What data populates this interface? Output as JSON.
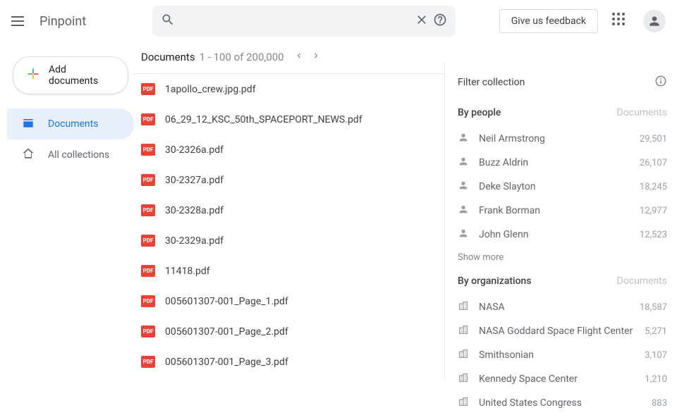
{
  "header": {
    "brand": "Pinpoint",
    "search_placeholder": "",
    "feedback_label": "Give us feedback"
  },
  "sidebar": {
    "add_label": "Add documents",
    "nav": [
      {
        "label": "Documents",
        "active": true
      },
      {
        "label": "All collections",
        "active": false
      }
    ]
  },
  "docs": {
    "title": "Documents",
    "range": "1 - 100 of 200,000",
    "items": [
      {
        "name": "1apollo_crew.jpg.pdf"
      },
      {
        "name": "06_29_12_KSC_50th_SPACEPORT_NEWS.pdf"
      },
      {
        "name": "30-2326a.pdf"
      },
      {
        "name": "30-2327a.pdf"
      },
      {
        "name": "30-2328a.pdf"
      },
      {
        "name": "30-2329a.pdf"
      },
      {
        "name": "11418.pdf"
      },
      {
        "name": "005601307-001_Page_1.pdf"
      },
      {
        "name": "005601307-001_Page_2.pdf"
      },
      {
        "name": "005601307-001_Page_3.pdf"
      }
    ]
  },
  "filter": {
    "title": "Filter collection",
    "people": {
      "label": "By people",
      "doclabel": "Documents",
      "items": [
        {
          "name": "Neil Armstrong",
          "count": "29,501"
        },
        {
          "name": "Buzz Aldrin",
          "count": "26,107"
        },
        {
          "name": "Deke Slayton",
          "count": "18,245"
        },
        {
          "name": "Frank Borman",
          "count": "12,977"
        },
        {
          "name": "John Glenn",
          "count": "12,523"
        }
      ],
      "show_more": "Show more"
    },
    "orgs": {
      "label": "By organizations",
      "doclabel": "Documents",
      "items": [
        {
          "name": "NASA",
          "count": "18,587"
        },
        {
          "name": "NASA Goddard Space Flight Center",
          "count": "5,271"
        },
        {
          "name": "Smithsonian",
          "count": "3,107"
        },
        {
          "name": "Kennedy Space Center",
          "count": "1,210"
        },
        {
          "name": "United States Congress",
          "count": "883"
        }
      ]
    }
  }
}
